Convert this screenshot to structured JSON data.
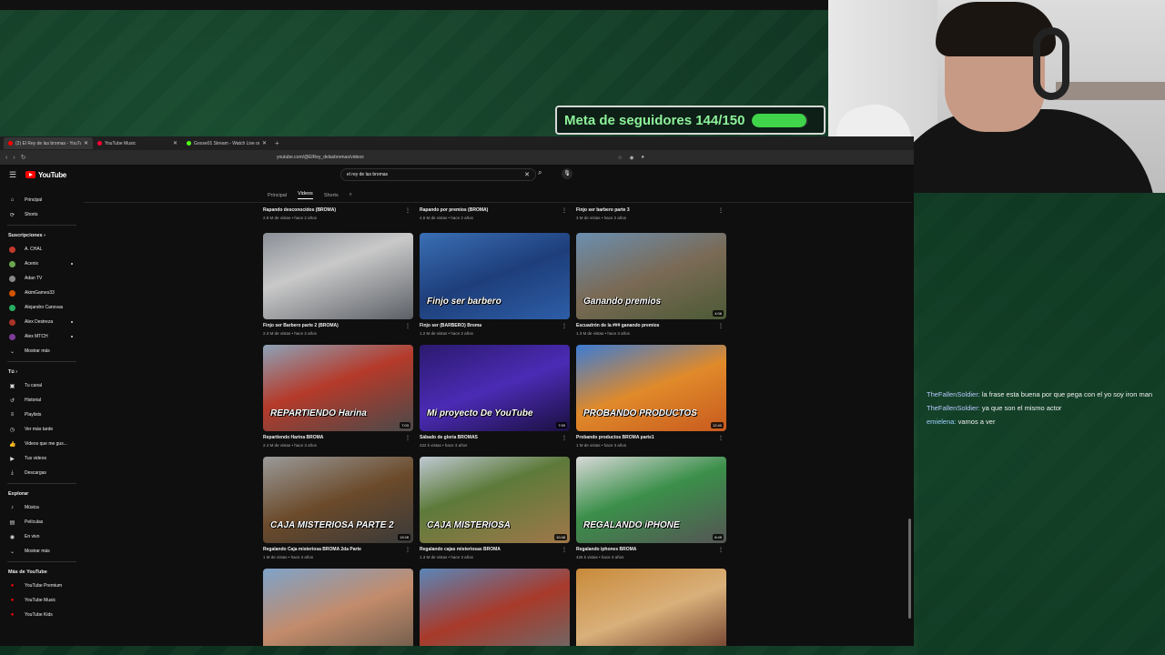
{
  "goal": {
    "label": "Meta de seguidores 144/150",
    "progress": 0.96
  },
  "browser": {
    "tabs": [
      {
        "title": "(2) El Rey de las bromas - YouTube",
        "color": "#ff0000",
        "active": true
      },
      {
        "title": "YouTube Music",
        "color": "#ff0033",
        "active": false
      },
      {
        "title": "Goose01 Stream - Watch Live on Kick",
        "color": "#53fc18",
        "active": false
      }
    ],
    "url": "youtube.com/@ElRey_delasbromas/videos"
  },
  "youtube": {
    "logo": "YouTube",
    "search_value": "el rey de las bromas",
    "channel_tabs": [
      "Principal",
      "Videos",
      "Shorts"
    ],
    "active_tab": "Videos",
    "sidebar": {
      "top": [
        {
          "label": "Principal",
          "icon": "home-icon",
          "glyph": "⌂"
        },
        {
          "label": "Shorts",
          "icon": "shorts-icon",
          "glyph": "⟳"
        }
      ],
      "subs_title": "Suscripciones",
      "subs": [
        {
          "label": "A. CHAL",
          "color": "#c0392b",
          "dot": false
        },
        {
          "label": "Acenix",
          "color": "#6aa84f",
          "dot": true
        },
        {
          "label": "Adan TV",
          "color": "#888888",
          "dot": false
        },
        {
          "label": "AkimGames33",
          "color": "#d35400",
          "dot": false
        },
        {
          "label": "Alejandro Canovas",
          "color": "#27ae60",
          "dot": false
        },
        {
          "label": "Alex Destreza",
          "color": "#a93226",
          "dot": true
        },
        {
          "label": "Alex MTCH",
          "color": "#7d3c98",
          "dot": true
        }
      ],
      "show_more": "Mostrar más",
      "you_title": "Tú",
      "you": [
        {
          "label": "Tu canal",
          "glyph": "▣"
        },
        {
          "label": "Historial",
          "glyph": "↺"
        },
        {
          "label": "Playlists",
          "glyph": "≡"
        },
        {
          "label": "Ver más tarde",
          "glyph": "◷"
        },
        {
          "label": "Videos que me gus...",
          "glyph": "👍"
        },
        {
          "label": "Tus videos",
          "glyph": "▶"
        },
        {
          "label": "Descargas",
          "glyph": "⤓"
        }
      ],
      "explore_title": "Explorar",
      "explore": [
        {
          "label": "Música",
          "glyph": "♪"
        },
        {
          "label": "Películas",
          "glyph": "▤"
        },
        {
          "label": "En vivo",
          "glyph": "◉"
        }
      ],
      "show_more_2": "Mostrar más",
      "more_title": "Más de YouTube",
      "more": [
        {
          "label": "YouTube Premium"
        },
        {
          "label": "YouTube Music"
        },
        {
          "label": "YouTube Kids"
        }
      ]
    },
    "top_row": [
      {
        "title": "Rapando desconocidos (BROMA)",
        "meta": "2.8 M de vistas • hace 2 años"
      },
      {
        "title": "Rapando por premios  (BROMA)",
        "meta": "4.6 M de vistas • hace 2 años"
      },
      {
        "title": "Finjo ser barbero parte 3",
        "meta": "3 M de vistas • hace 2 años"
      }
    ],
    "videos": [
      [
        {
          "title": "Finjo ser Barbero parte 2 (BROMA)",
          "meta": "2.3 M de vistas • hace 2 años",
          "duration": "",
          "overlay": "",
          "bg": "linear-gradient(160deg,#8a8f96,#c9c9c9 40%,#5c6066)"
        },
        {
          "title": "Finjo ser (BARBERO) Broma",
          "meta": "1.2 M de vistas • hace 2 años",
          "duration": "",
          "overlay": "Finjo ser barbero",
          "bg": "linear-gradient(160deg,#3a6fb5,#1e3e7a 50%,#2d5ea8)"
        },
        {
          "title": "Escuadrón de la ### ganando premios",
          "meta": "1.3 M de vistas • hace 3 años",
          "duration": "4:06",
          "overlay": "Ganando premios",
          "bg": "linear-gradient(160deg,#6b8fb0,#7a6a55 50%,#4c5a36)"
        }
      ],
      [
        {
          "title": "Repartiendo Harina BROMA",
          "meta": "2.4 M de vistas • hace 3 años",
          "duration": "7:03",
          "overlay": "REPARTIENDO Harina",
          "bg": "linear-gradient(160deg,#8da3b8,#b53a2a 45%,#4a4a4a)"
        },
        {
          "title": "Sábado de gloria BROMAS",
          "meta": "222 k vistas • hace 3 años",
          "duration": "7:59",
          "overlay": "Mi proyecto De YouTube",
          "bg": "linear-gradient(160deg,#2b1a6e,#4b2bb5 50%,#1a1040)"
        },
        {
          "title": "Probando productos BROMA parte1",
          "meta": "1 M de vistas • hace 3 años",
          "duration": "12:40",
          "overlay": "PROBANDO PRODUCTOS",
          "bg": "linear-gradient(160deg,#3b7bd4,#e08a2a 50%,#c85a1e)"
        }
      ],
      [
        {
          "title": "Regalando Caja misteriosa BROMA 2da Parte",
          "meta": "1 M de vistas • hace 3 años",
          "duration": "13:28",
          "overlay": "CAJA MISTERIOSA PARTE 2",
          "bg": "linear-gradient(160deg,#9a9a9a,#6b4a2a 50%,#3a3a3a)"
        },
        {
          "title": "Regalando cajas misteriosas BROMA",
          "meta": "1.3 M de vistas • hace 3 años",
          "duration": "10:48",
          "overlay": "CAJA MISTERIOSA",
          "bg": "linear-gradient(160deg,#bfc9d3,#5d7a3a 40%,#a0784a)"
        },
        {
          "title": "Regalando iphones BROMA",
          "meta": "426 k vistas • hace 3 años",
          "duration": "8:49",
          "overlay": "REGALANDO iPHONE",
          "bg": "linear-gradient(160deg,#d9d9d9,#3b8f4a 45%,#555)"
        }
      ],
      [
        {
          "title": "",
          "meta": "",
          "duration": "",
          "overlay": "",
          "bg": "linear-gradient(160deg,#7ea3c9,#c28b6b 50%,#6b5a4a)"
        },
        {
          "title": "",
          "meta": "",
          "duration": "",
          "overlay": "",
          "bg": "linear-gradient(160deg,#5a86b8,#a83a2a 50%,#6b6b6b)"
        },
        {
          "title": "",
          "meta": "",
          "duration": "",
          "overlay": "",
          "bg": "linear-gradient(160deg,#c98a3a,#d9b07a 50%,#6b3a2a)"
        }
      ]
    ]
  },
  "chat": [
    {
      "user": "TheFallenSoldier",
      "text": "la frase esta buena por que pega con el yo soy iron man"
    },
    {
      "user": "TheFallenSoldier",
      "text": "ya que son el mismo actor"
    },
    {
      "user": "emielena",
      "text": "vamos a ver"
    }
  ]
}
